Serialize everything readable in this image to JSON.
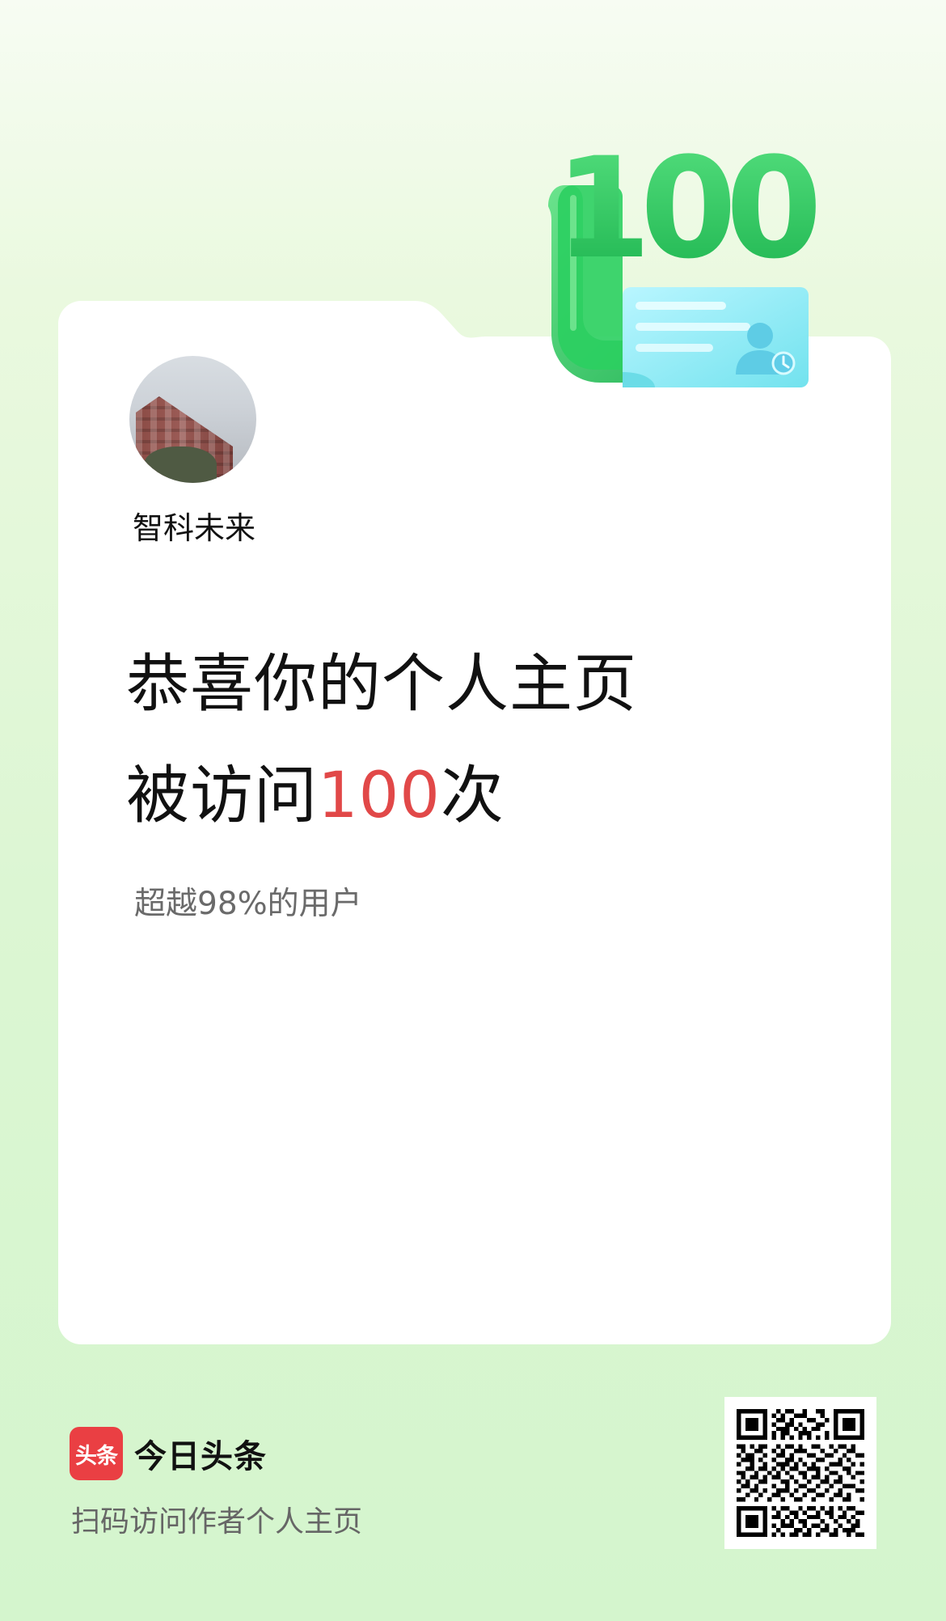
{
  "card": {
    "author_name": "智科未来",
    "headline_line1": "恭喜你的个人主页",
    "headline_line2_prefix": "被访问",
    "headline_line2_number": "100",
    "headline_line2_suffix": "次",
    "subline": "超越98%的用户"
  },
  "badge": {
    "count": "100"
  },
  "footer": {
    "brand_icon_text": "头条",
    "brand_name": "今日头条",
    "scan_text": "扫码访问作者个人主页"
  },
  "colors": {
    "background_top": "#f7fcf3",
    "background_bottom": "#d4f5cd",
    "accent_green": "#28c25a",
    "highlight_red": "#e14848",
    "brand_red": "#ea3f43"
  },
  "icons": {
    "badge_icon": "user-clock-icon",
    "brand_icon": "toutiao-icon",
    "qr_icon": "qr-code-icon"
  }
}
